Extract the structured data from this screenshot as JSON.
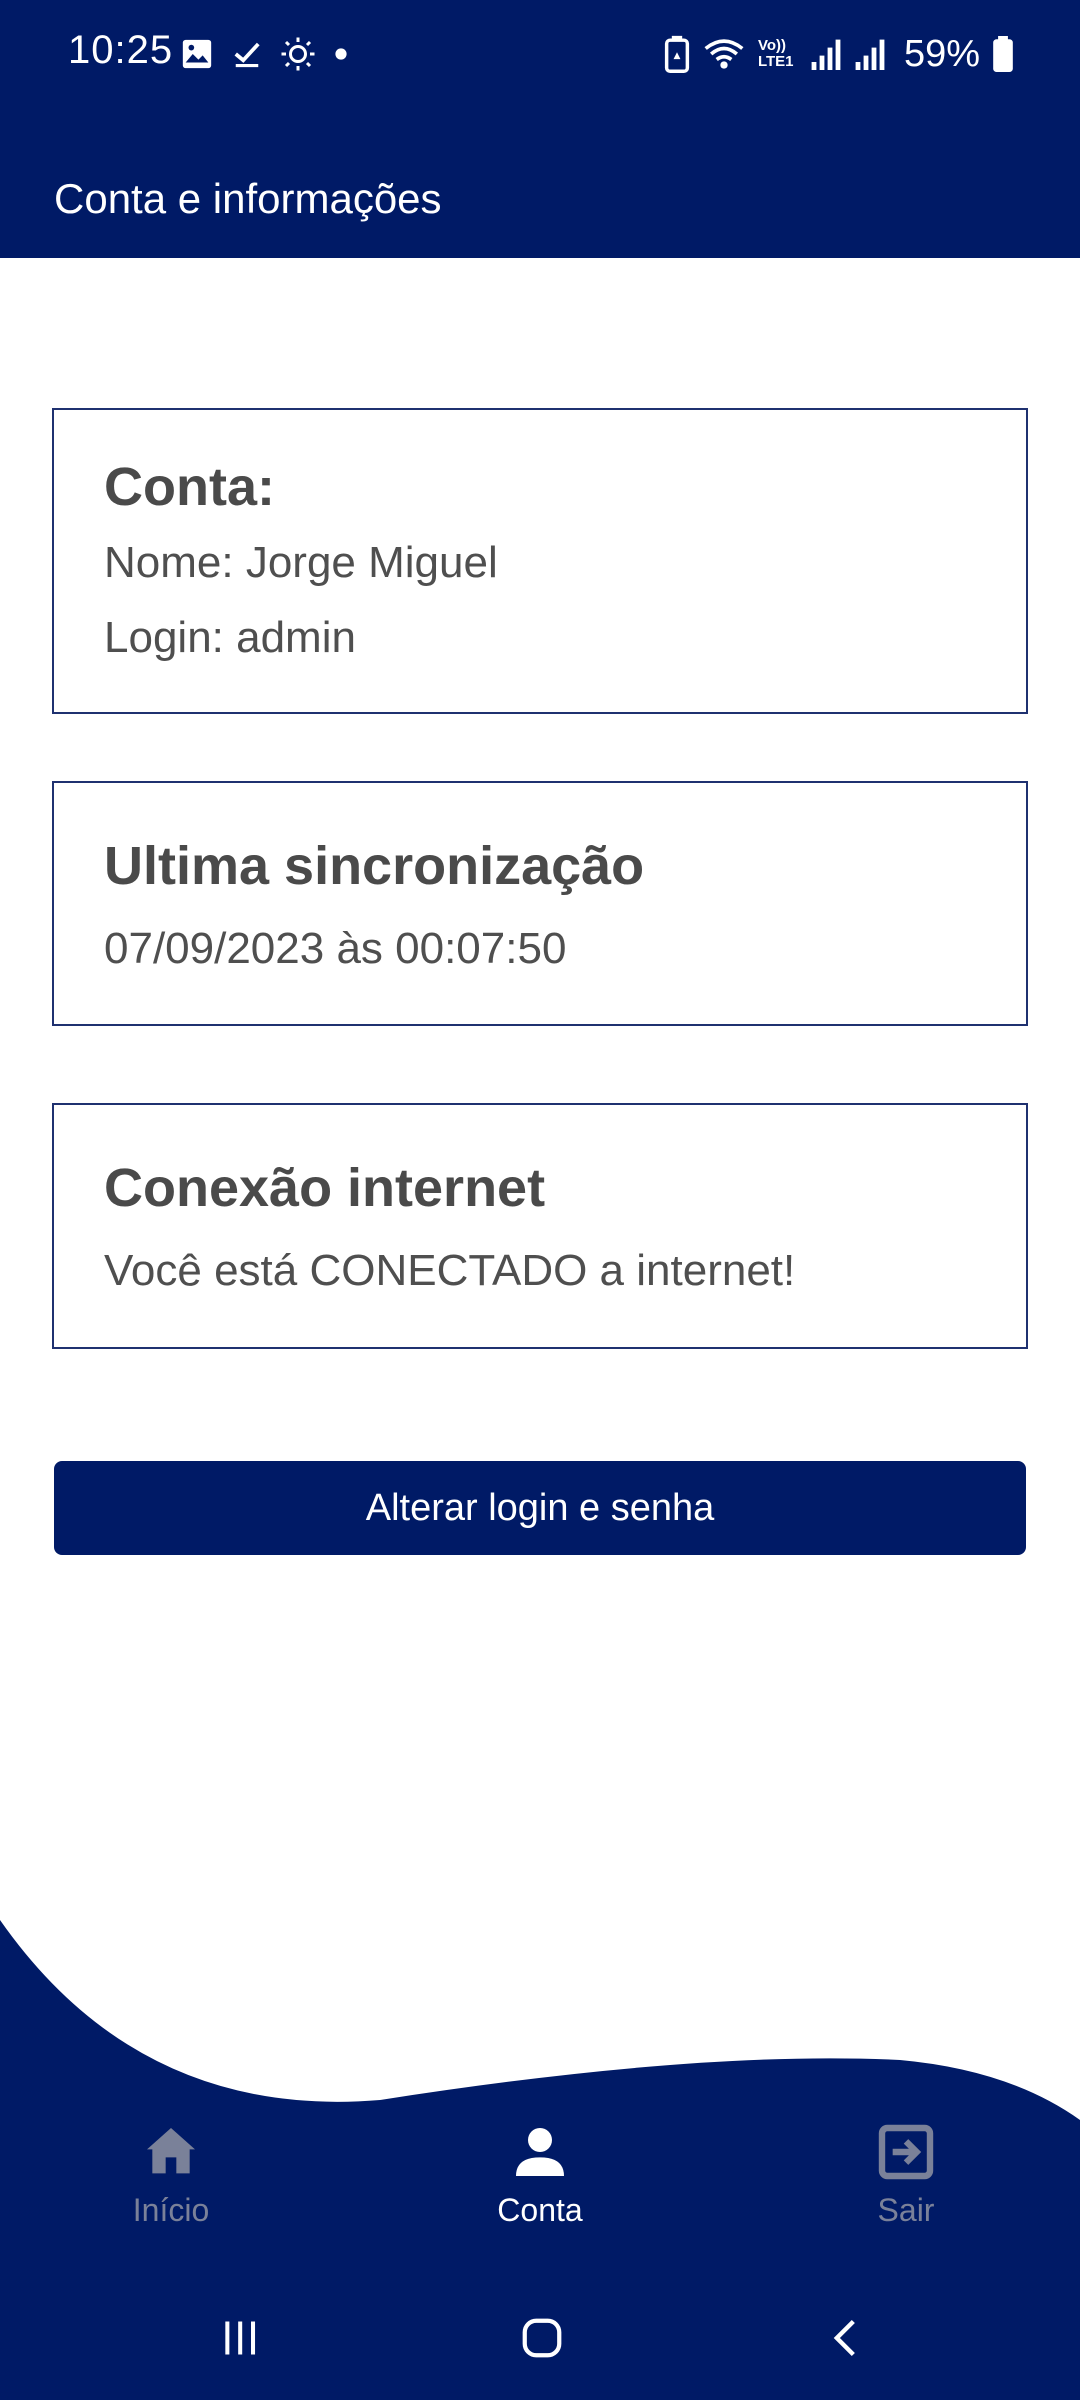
{
  "status_bar": {
    "time": "10:25",
    "battery_percent": "59%",
    "left_icons": [
      "image-icon",
      "check-icon",
      "brightness-icon",
      "dot-icon"
    ],
    "right_icons": [
      "battery-saver-icon",
      "wifi-icon",
      "volte-icon",
      "signal-icon",
      "signal-icon",
      "battery-icon"
    ],
    "volte_label": "Vo)) LTE1"
  },
  "header": {
    "title": "Conta e informações",
    "background_color": "#001A66"
  },
  "cards": {
    "account": {
      "title": "Conta:",
      "name_line": "Nome: Jorge Miguel",
      "login_line": "Login: admin"
    },
    "sync": {
      "title": "Ultima sincronização",
      "value": "07/09/2023 às 00:07:50"
    },
    "internet": {
      "title": "Conexão internet",
      "value": "Você está CONECTADO a internet!"
    }
  },
  "actions": {
    "change_login_label": "Alterar login e senha"
  },
  "bottom_nav": {
    "items": [
      {
        "label": "Início",
        "icon": "home-icon",
        "active": false
      },
      {
        "label": "Conta",
        "icon": "person-icon",
        "active": true
      },
      {
        "label": "Sair",
        "icon": "logout-icon",
        "active": false
      }
    ],
    "active_color": "#ffffff",
    "inactive_color": "#7A8199"
  },
  "system_nav": {
    "buttons": [
      "recent-apps-icon",
      "home-button-icon",
      "back-icon"
    ]
  },
  "colors": {
    "brand_navy": "#001A66",
    "card_border": "#1F3170",
    "text_gray": "#4f4f4f"
  }
}
